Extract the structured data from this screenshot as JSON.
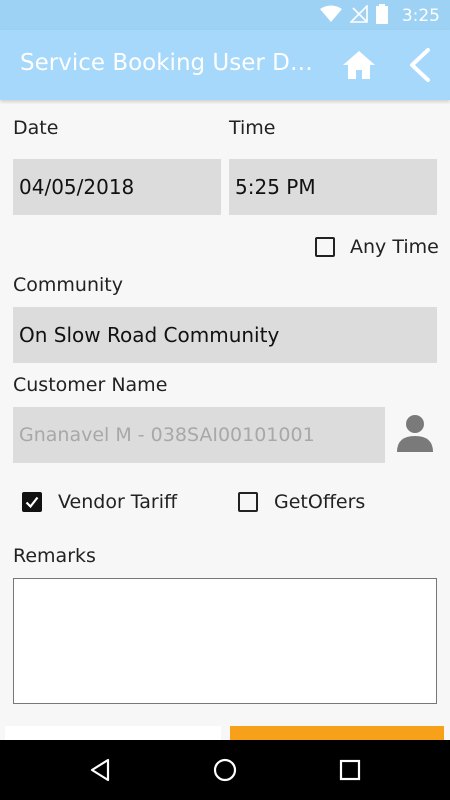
{
  "status_bar": {
    "time": "3:25",
    "icons": [
      "wifi-icon",
      "no-signal-icon",
      "battery-icon"
    ]
  },
  "app_bar": {
    "title": "Service Booking User Det…",
    "home_icon": "home-icon",
    "back_icon": "chevron-left-icon"
  },
  "form": {
    "date_label": "Date",
    "date_value": "04/05/2018",
    "time_label": "Time",
    "time_value": "5:25 PM",
    "any_time_label": "Any Time",
    "any_time_checked": false,
    "community_label": "Community",
    "community_value": "On Slow Road Community",
    "customer_label": "Customer Name",
    "customer_value": "Gnanavel M - 038SAI00101001",
    "customer_icon": "person-icon",
    "vendor_tariff_label": "Vendor Tariff",
    "vendor_tariff_checked": true,
    "get_offers_label": "GetOffers",
    "get_offers_checked": false,
    "remarks_label": "Remarks",
    "remarks_value": ""
  },
  "nav_bar": {
    "icons": [
      "back-triangle-icon",
      "home-circle-icon",
      "recents-square-icon"
    ]
  },
  "colors": {
    "app_bar": "#a5d8fb",
    "field_bg": "#dcdcdc",
    "accent_button": "#f7a11a"
  }
}
